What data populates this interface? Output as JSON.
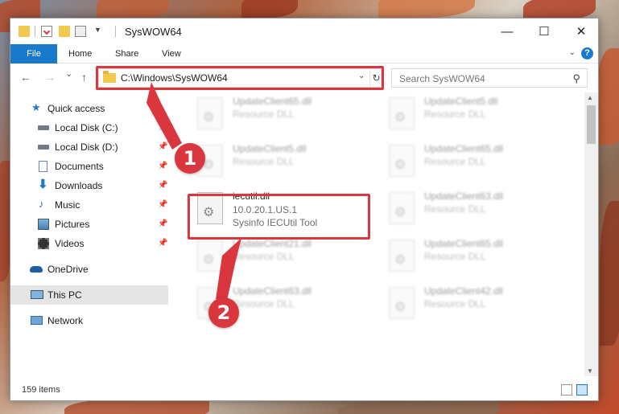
{
  "window": {
    "title": "SysWOW64",
    "controls": {
      "minimize": "—",
      "maximize": "☐",
      "close": "✕"
    }
  },
  "ribbon": {
    "tabs": [
      {
        "label": "File"
      },
      {
        "label": "Home"
      },
      {
        "label": "Share"
      },
      {
        "label": "View"
      }
    ],
    "help": "?"
  },
  "nav": {
    "back": "←",
    "forward": "→",
    "recent": "⌄",
    "up": "↑",
    "address": "C:\\Windows\\SysWOW64",
    "refresh": "↻",
    "dropdown": "⌄",
    "search_placeholder": "Search SysWOW64"
  },
  "sidebar": {
    "items": [
      {
        "label": "Quick access",
        "icon": "star-icon",
        "pinned": false
      },
      {
        "label": "Local Disk (C:)",
        "icon": "drive-icon",
        "pinned": true
      },
      {
        "label": "Local Disk (D:)",
        "icon": "drive-icon",
        "pinned": true
      },
      {
        "label": "Documents",
        "icon": "documents-icon",
        "pinned": true
      },
      {
        "label": "Downloads",
        "icon": "download-icon",
        "pinned": true
      },
      {
        "label": "Music",
        "icon": "music-icon",
        "pinned": true
      },
      {
        "label": "Pictures",
        "icon": "pictures-icon",
        "pinned": true
      },
      {
        "label": "Videos",
        "icon": "videos-icon",
        "pinned": true
      },
      {
        "label": "OneDrive",
        "icon": "cloud-icon",
        "pinned": false
      },
      {
        "label": "This PC",
        "icon": "computer-icon",
        "pinned": false,
        "selected": true
      },
      {
        "label": "Network",
        "icon": "network-icon",
        "pinned": false
      }
    ],
    "pin_glyph": "📌"
  },
  "files": {
    "left_column": [
      {
        "name": "UpdateClient65.dll",
        "type": "Resource DLL"
      },
      {
        "name": "UpdateClient5.dll",
        "type": "Resource DLL"
      },
      {
        "name": "iecutil.dll",
        "version": "10.0.20.1.US.1",
        "description": "Sysinfo IECUtil Tool",
        "highlighted": true
      },
      {
        "name": "UpdateClient21.dll",
        "type": "Resource DLL"
      },
      {
        "name": "UpdateClient63.dll",
        "type": "Resource DLL"
      }
    ],
    "right_column": [
      {
        "name": "UpdateClient5.dll",
        "type": "Resource DLL"
      },
      {
        "name": "UpdateClient65.dll",
        "type": "Resource DLL"
      },
      {
        "name": "UpdateClient63.dll",
        "type": "Resource DLL"
      },
      {
        "name": "UpdateClient65.dll",
        "type": "Resource DLL"
      },
      {
        "name": "UpdateClient42.dll",
        "type": "Resource DLL"
      }
    ]
  },
  "status": {
    "item_count": "159 items"
  },
  "annotations": {
    "step1": "1",
    "step2": "2"
  },
  "colors": {
    "accent": "#1979ca",
    "highlight_red": "#d9363e"
  }
}
